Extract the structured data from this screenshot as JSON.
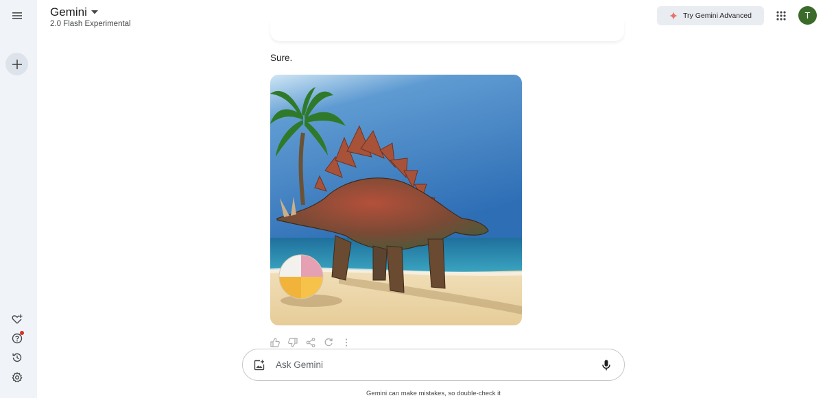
{
  "header": {
    "app_name": "Gemini",
    "model_name": "2.0 Flash Experimental",
    "try_advanced_label": "Try Gemini Advanced",
    "avatar_initial": "T"
  },
  "conversation": {
    "response_text": "Sure.",
    "image": {
      "depicts": "stegosaurus-on-beach-with-palm-tree-and-beach-ball"
    }
  },
  "response_actions": [
    "thumb-up-icon",
    "thumb-down-icon",
    "share-icon",
    "regenerate-icon",
    "more-vert-icon"
  ],
  "input": {
    "placeholder": "Ask Gemini",
    "value": ""
  },
  "footer": {
    "disclaimer": "Gemini can make mistakes, so double-check it"
  },
  "sidebar": {
    "top_icons": [
      "menu-icon",
      "new-chat-icon"
    ],
    "bottom_icons": [
      "gem-manager-icon",
      "help-icon",
      "activity-icon",
      "settings-icon"
    ]
  },
  "colors": {
    "rail_bg": "#f0f4f9",
    "avatar_bg": "#3b6b2b",
    "sparkle": "#e8706f",
    "notification_dot": "#d93025"
  }
}
